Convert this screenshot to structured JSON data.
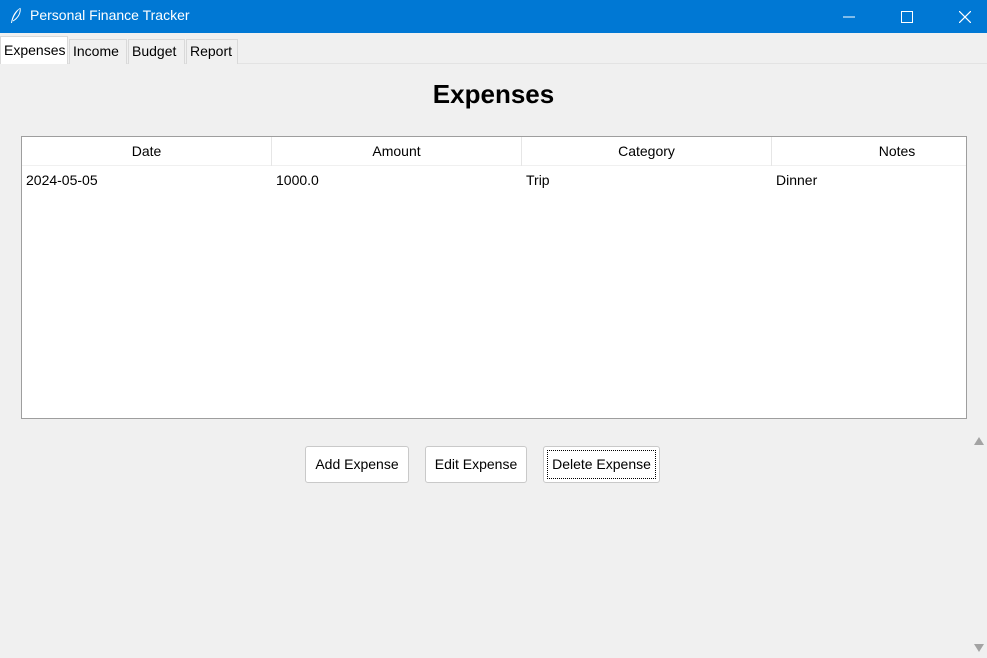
{
  "window": {
    "title": "Personal Finance Tracker",
    "app_icon": "feather-icon",
    "title_bar_color": "#0078d4",
    "controls": [
      "minimize-icon",
      "maximize-icon",
      "close-icon"
    ]
  },
  "tabs": [
    {
      "label": "Expenses",
      "active": true
    },
    {
      "label": "Income",
      "active": false
    },
    {
      "label": "Budget",
      "active": false
    },
    {
      "label": "Report",
      "active": false
    }
  ],
  "main": {
    "heading": "Expenses",
    "table": {
      "columns": [
        "Date",
        "Amount",
        "Category",
        "Notes"
      ],
      "rows": [
        [
          "2024-05-05",
          "1000.0",
          "Trip",
          "Dinner"
        ]
      ]
    },
    "buttons": {
      "add": "Add Expense",
      "edit": "Edit Expense",
      "delete": "Delete Expense"
    }
  }
}
